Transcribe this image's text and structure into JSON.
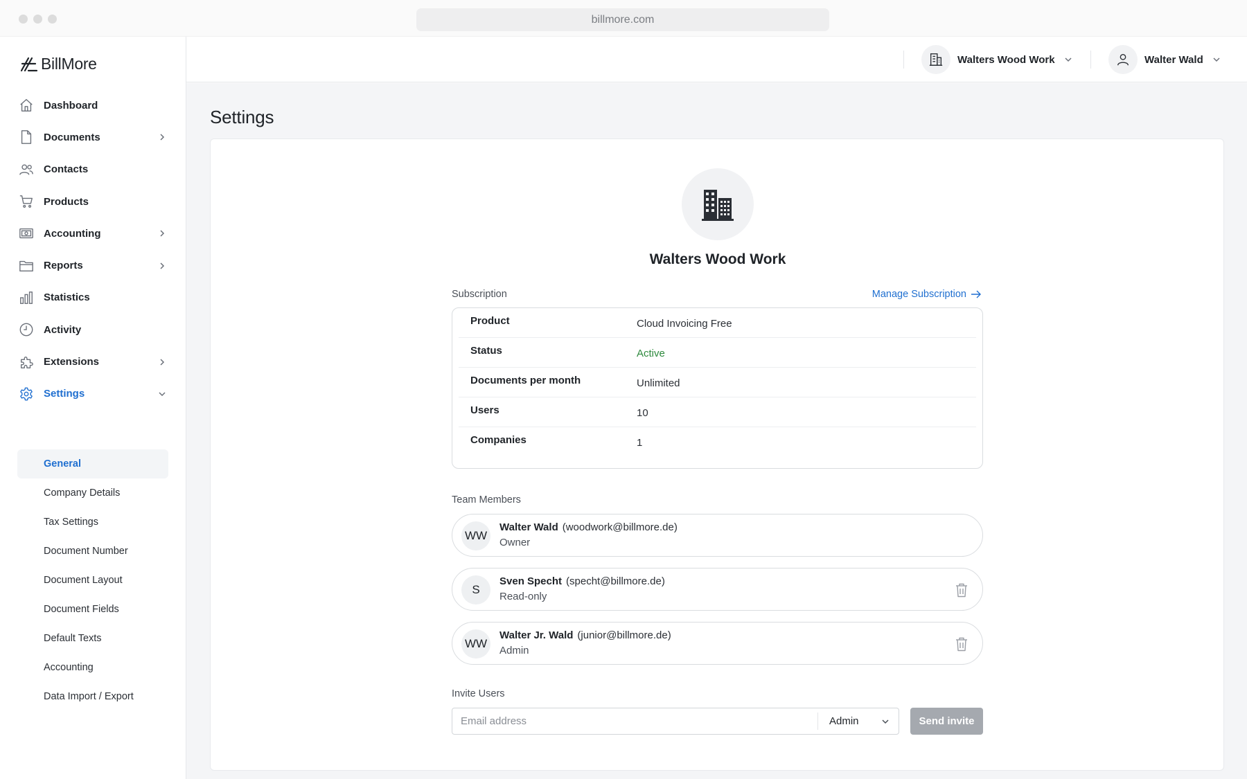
{
  "browser": {
    "url": "billmore.com"
  },
  "app": {
    "logo_text": "BillMore"
  },
  "sidebar": {
    "items": [
      {
        "label": "Dashboard",
        "icon": "home-icon",
        "has_chevron": false
      },
      {
        "label": "Documents",
        "icon": "document-icon",
        "has_chevron": true
      },
      {
        "label": "Contacts",
        "icon": "users-icon",
        "has_chevron": false
      },
      {
        "label": "Products",
        "icon": "cart-icon",
        "has_chevron": false
      },
      {
        "label": "Accounting",
        "icon": "banknote-icon",
        "has_chevron": true
      },
      {
        "label": "Reports",
        "icon": "folder-icon",
        "has_chevron": true
      },
      {
        "label": "Statistics",
        "icon": "bar-chart-icon",
        "has_chevron": false
      },
      {
        "label": "Activity",
        "icon": "clock-icon",
        "has_chevron": false
      },
      {
        "label": "Extensions",
        "icon": "puzzle-icon",
        "has_chevron": true
      },
      {
        "label": "Settings",
        "icon": "gear-icon",
        "has_chevron": true,
        "active": true
      }
    ],
    "settings_subitems": [
      {
        "label": "General",
        "active": true
      },
      {
        "label": "Company Details"
      },
      {
        "label": "Tax Settings"
      },
      {
        "label": "Document Number"
      },
      {
        "label": "Document Layout"
      },
      {
        "label": "Document Fields"
      },
      {
        "label": "Default Texts"
      },
      {
        "label": "Accounting"
      },
      {
        "label": "Data Import / Export"
      }
    ]
  },
  "header": {
    "company_switcher": "Walters Wood Work",
    "user_menu": "Walter Wald"
  },
  "page": {
    "title": "Settings",
    "company_name": "Walters Wood Work",
    "subscription": {
      "label": "Subscription",
      "manage_link": "Manage Subscription",
      "rows": [
        {
          "key": "Product",
          "value": "Cloud Invoicing Free"
        },
        {
          "key": "Status",
          "value": "Active"
        },
        {
          "key": "Documents per month",
          "value": "Unlimited"
        },
        {
          "key": "Users",
          "value": "10"
        },
        {
          "key": "Companies",
          "value": "1"
        }
      ]
    },
    "team": {
      "label": "Team Members",
      "members": [
        {
          "initials": "WW",
          "name": "Walter Wald",
          "email": "(woodwork@billmore.de)",
          "role": "Owner",
          "deletable": false
        },
        {
          "initials": "S",
          "name": "Sven Specht",
          "email": "(specht@billmore.de)",
          "role": "Read-only",
          "deletable": true
        },
        {
          "initials": "WW",
          "name": "Walter Jr. Wald",
          "email": "(junior@billmore.de)",
          "role": "Admin",
          "deletable": true
        }
      ]
    },
    "invite": {
      "label": "Invite Users",
      "email_placeholder": "Email address",
      "email_value": "",
      "role_selected": "Admin",
      "send_label": "Send invite"
    }
  },
  "colors": {
    "accent": "#1f6fd0",
    "status_active": "#2e8a3e",
    "button_disabled": "#a5a9af",
    "main_bg": "#f4f5f7"
  }
}
